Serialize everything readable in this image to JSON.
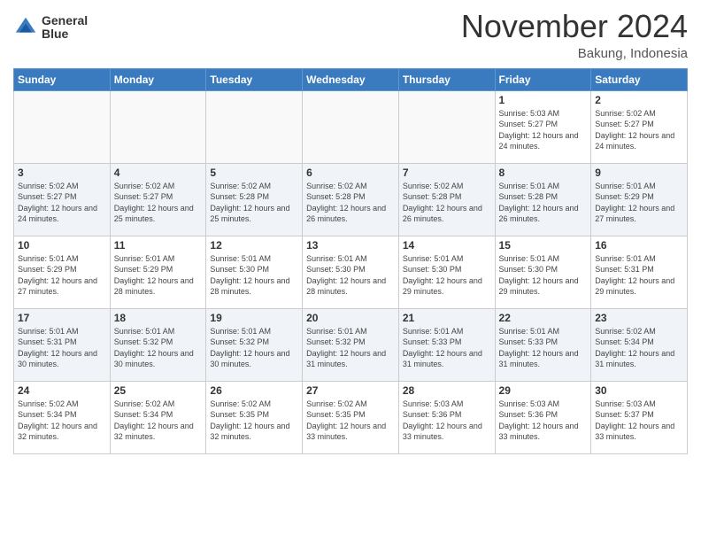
{
  "header": {
    "logo_line1": "General",
    "logo_line2": "Blue",
    "month_title": "November 2024",
    "location": "Bakung, Indonesia"
  },
  "weekdays": [
    "Sunday",
    "Monday",
    "Tuesday",
    "Wednesday",
    "Thursday",
    "Friday",
    "Saturday"
  ],
  "weeks": [
    [
      {
        "day": "",
        "sunrise": "",
        "sunset": "",
        "daylight": "",
        "empty": true
      },
      {
        "day": "",
        "sunrise": "",
        "sunset": "",
        "daylight": "",
        "empty": true
      },
      {
        "day": "",
        "sunrise": "",
        "sunset": "",
        "daylight": "",
        "empty": true
      },
      {
        "day": "",
        "sunrise": "",
        "sunset": "",
        "daylight": "",
        "empty": true
      },
      {
        "day": "",
        "sunrise": "",
        "sunset": "",
        "daylight": "",
        "empty": true
      },
      {
        "day": "1",
        "sunrise": "Sunrise: 5:03 AM",
        "sunset": "Sunset: 5:27 PM",
        "daylight": "Daylight: 12 hours and 24 minutes.",
        "empty": false
      },
      {
        "day": "2",
        "sunrise": "Sunrise: 5:02 AM",
        "sunset": "Sunset: 5:27 PM",
        "daylight": "Daylight: 12 hours and 24 minutes.",
        "empty": false
      }
    ],
    [
      {
        "day": "3",
        "sunrise": "Sunrise: 5:02 AM",
        "sunset": "Sunset: 5:27 PM",
        "daylight": "Daylight: 12 hours and 24 minutes.",
        "empty": false
      },
      {
        "day": "4",
        "sunrise": "Sunrise: 5:02 AM",
        "sunset": "Sunset: 5:27 PM",
        "daylight": "Daylight: 12 hours and 25 minutes.",
        "empty": false
      },
      {
        "day": "5",
        "sunrise": "Sunrise: 5:02 AM",
        "sunset": "Sunset: 5:28 PM",
        "daylight": "Daylight: 12 hours and 25 minutes.",
        "empty": false
      },
      {
        "day": "6",
        "sunrise": "Sunrise: 5:02 AM",
        "sunset": "Sunset: 5:28 PM",
        "daylight": "Daylight: 12 hours and 26 minutes.",
        "empty": false
      },
      {
        "day": "7",
        "sunrise": "Sunrise: 5:02 AM",
        "sunset": "Sunset: 5:28 PM",
        "daylight": "Daylight: 12 hours and 26 minutes.",
        "empty": false
      },
      {
        "day": "8",
        "sunrise": "Sunrise: 5:01 AM",
        "sunset": "Sunset: 5:28 PM",
        "daylight": "Daylight: 12 hours and 26 minutes.",
        "empty": false
      },
      {
        "day": "9",
        "sunrise": "Sunrise: 5:01 AM",
        "sunset": "Sunset: 5:29 PM",
        "daylight": "Daylight: 12 hours and 27 minutes.",
        "empty": false
      }
    ],
    [
      {
        "day": "10",
        "sunrise": "Sunrise: 5:01 AM",
        "sunset": "Sunset: 5:29 PM",
        "daylight": "Daylight: 12 hours and 27 minutes.",
        "empty": false
      },
      {
        "day": "11",
        "sunrise": "Sunrise: 5:01 AM",
        "sunset": "Sunset: 5:29 PM",
        "daylight": "Daylight: 12 hours and 28 minutes.",
        "empty": false
      },
      {
        "day": "12",
        "sunrise": "Sunrise: 5:01 AM",
        "sunset": "Sunset: 5:30 PM",
        "daylight": "Daylight: 12 hours and 28 minutes.",
        "empty": false
      },
      {
        "day": "13",
        "sunrise": "Sunrise: 5:01 AM",
        "sunset": "Sunset: 5:30 PM",
        "daylight": "Daylight: 12 hours and 28 minutes.",
        "empty": false
      },
      {
        "day": "14",
        "sunrise": "Sunrise: 5:01 AM",
        "sunset": "Sunset: 5:30 PM",
        "daylight": "Daylight: 12 hours and 29 minutes.",
        "empty": false
      },
      {
        "day": "15",
        "sunrise": "Sunrise: 5:01 AM",
        "sunset": "Sunset: 5:30 PM",
        "daylight": "Daylight: 12 hours and 29 minutes.",
        "empty": false
      },
      {
        "day": "16",
        "sunrise": "Sunrise: 5:01 AM",
        "sunset": "Sunset: 5:31 PM",
        "daylight": "Daylight: 12 hours and 29 minutes.",
        "empty": false
      }
    ],
    [
      {
        "day": "17",
        "sunrise": "Sunrise: 5:01 AM",
        "sunset": "Sunset: 5:31 PM",
        "daylight": "Daylight: 12 hours and 30 minutes.",
        "empty": false
      },
      {
        "day": "18",
        "sunrise": "Sunrise: 5:01 AM",
        "sunset": "Sunset: 5:32 PM",
        "daylight": "Daylight: 12 hours and 30 minutes.",
        "empty": false
      },
      {
        "day": "19",
        "sunrise": "Sunrise: 5:01 AM",
        "sunset": "Sunset: 5:32 PM",
        "daylight": "Daylight: 12 hours and 30 minutes.",
        "empty": false
      },
      {
        "day": "20",
        "sunrise": "Sunrise: 5:01 AM",
        "sunset": "Sunset: 5:32 PM",
        "daylight": "Daylight: 12 hours and 31 minutes.",
        "empty": false
      },
      {
        "day": "21",
        "sunrise": "Sunrise: 5:01 AM",
        "sunset": "Sunset: 5:33 PM",
        "daylight": "Daylight: 12 hours and 31 minutes.",
        "empty": false
      },
      {
        "day": "22",
        "sunrise": "Sunrise: 5:01 AM",
        "sunset": "Sunset: 5:33 PM",
        "daylight": "Daylight: 12 hours and 31 minutes.",
        "empty": false
      },
      {
        "day": "23",
        "sunrise": "Sunrise: 5:02 AM",
        "sunset": "Sunset: 5:34 PM",
        "daylight": "Daylight: 12 hours and 31 minutes.",
        "empty": false
      }
    ],
    [
      {
        "day": "24",
        "sunrise": "Sunrise: 5:02 AM",
        "sunset": "Sunset: 5:34 PM",
        "daylight": "Daylight: 12 hours and 32 minutes.",
        "empty": false
      },
      {
        "day": "25",
        "sunrise": "Sunrise: 5:02 AM",
        "sunset": "Sunset: 5:34 PM",
        "daylight": "Daylight: 12 hours and 32 minutes.",
        "empty": false
      },
      {
        "day": "26",
        "sunrise": "Sunrise: 5:02 AM",
        "sunset": "Sunset: 5:35 PM",
        "daylight": "Daylight: 12 hours and 32 minutes.",
        "empty": false
      },
      {
        "day": "27",
        "sunrise": "Sunrise: 5:02 AM",
        "sunset": "Sunset: 5:35 PM",
        "daylight": "Daylight: 12 hours and 33 minutes.",
        "empty": false
      },
      {
        "day": "28",
        "sunrise": "Sunrise: 5:03 AM",
        "sunset": "Sunset: 5:36 PM",
        "daylight": "Daylight: 12 hours and 33 minutes.",
        "empty": false
      },
      {
        "day": "29",
        "sunrise": "Sunrise: 5:03 AM",
        "sunset": "Sunset: 5:36 PM",
        "daylight": "Daylight: 12 hours and 33 minutes.",
        "empty": false
      },
      {
        "day": "30",
        "sunrise": "Sunrise: 5:03 AM",
        "sunset": "Sunset: 5:37 PM",
        "daylight": "Daylight: 12 hours and 33 minutes.",
        "empty": false
      }
    ]
  ]
}
